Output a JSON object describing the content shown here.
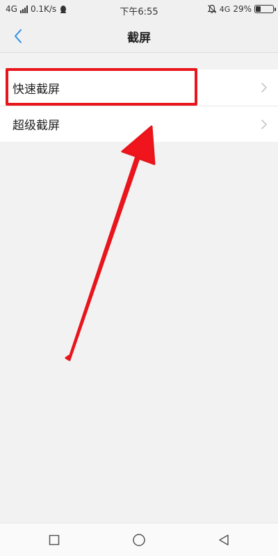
{
  "status_bar": {
    "network_left": "4G",
    "speed": "0.1K/s",
    "time": "下午6:55",
    "network_right": "4G",
    "battery_text": "29%",
    "battery_level": 0.29
  },
  "nav": {
    "title": "截屏"
  },
  "list": {
    "items": [
      {
        "label": "快速截屏"
      },
      {
        "label": "超级截屏"
      }
    ]
  },
  "annotation": {
    "highlight_color": "#e8151c",
    "arrow_color": "#f0141c"
  },
  "icons": {
    "back": "chevron-left-icon",
    "chevron": "chevron-right-icon",
    "home_square": "square-icon",
    "home_circle": "circle-icon",
    "home_triangle": "triangle-back-icon",
    "qq": "qq-penguin-icon",
    "mute": "bell-muted-icon"
  },
  "colors": {
    "accent_blue": "#2f8fe6",
    "text_primary": "#222222"
  }
}
